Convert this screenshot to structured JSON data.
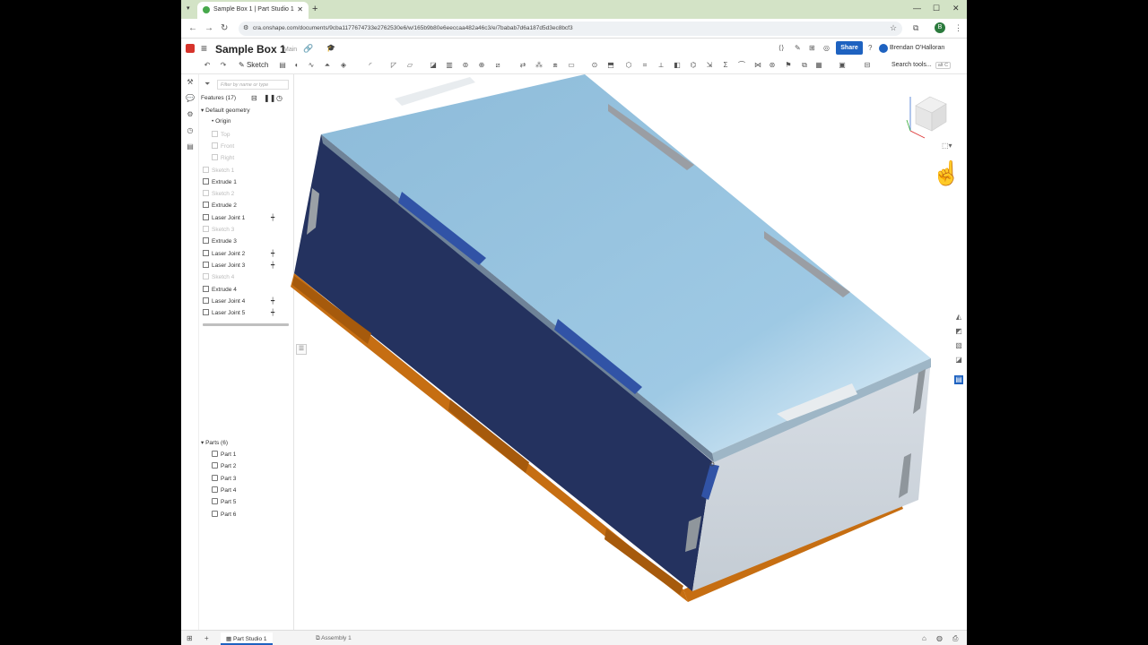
{
  "browser": {
    "tab_title": "Sample Box 1 | Part Studio 1",
    "url": "cra.onshape.com/documents/9cba1177674733e2762530e6/w/165b9b80e6eeccaa482a46c3/e/7babab7d6a187d5d3ec8bcf3",
    "profile_initial": "B"
  },
  "app": {
    "document_title": "Sample Box 1",
    "branch": "Main",
    "share_label": "Share",
    "user_name": "Brendan O'Halloran",
    "sketch_label": "Sketch",
    "search_tools_label": "Search tools...",
    "search_shortcut": "alt C"
  },
  "features": {
    "filter_placeholder": "Filter by name or type",
    "header": "Features (17)",
    "items": [
      {
        "label": "Default geometry",
        "kind": "group"
      },
      {
        "label": "Origin",
        "kind": "origin"
      },
      {
        "label": "Top",
        "kind": "plane"
      },
      {
        "label": "Front",
        "kind": "plane"
      },
      {
        "label": "Right",
        "kind": "plane"
      },
      {
        "label": "Sketch 1",
        "kind": "sketch"
      },
      {
        "label": "Extrude 1",
        "kind": "feature"
      },
      {
        "label": "Sketch 2",
        "kind": "sketch"
      },
      {
        "label": "Extrude 2",
        "kind": "feature"
      },
      {
        "label": "Laser Joint 1",
        "kind": "joint"
      },
      {
        "label": "Sketch 3",
        "kind": "sketch"
      },
      {
        "label": "Extrude 3",
        "kind": "feature"
      },
      {
        "label": "Laser Joint 2",
        "kind": "joint"
      },
      {
        "label": "Laser Joint 3",
        "kind": "joint"
      },
      {
        "label": "Sketch 4",
        "kind": "sketch"
      },
      {
        "label": "Extrude 4",
        "kind": "feature"
      },
      {
        "label": "Laser Joint 4",
        "kind": "joint"
      },
      {
        "label": "Laser Joint 5",
        "kind": "joint"
      }
    ]
  },
  "parts": {
    "header": "Parts (6)",
    "items": [
      "Part 1",
      "Part 2",
      "Part 3",
      "Part 4",
      "Part 5",
      "Part 6"
    ]
  },
  "bottom_tabs": [
    {
      "label": "Part Studio 1",
      "active": true
    },
    {
      "label": "Assembly 1",
      "active": false
    }
  ],
  "colors": {
    "top_face": "#9cc7e2",
    "front_face": "#24325f",
    "side_face": "#cbd3db",
    "bottom_edge": "#c66e12",
    "share": "#1e62c0"
  }
}
